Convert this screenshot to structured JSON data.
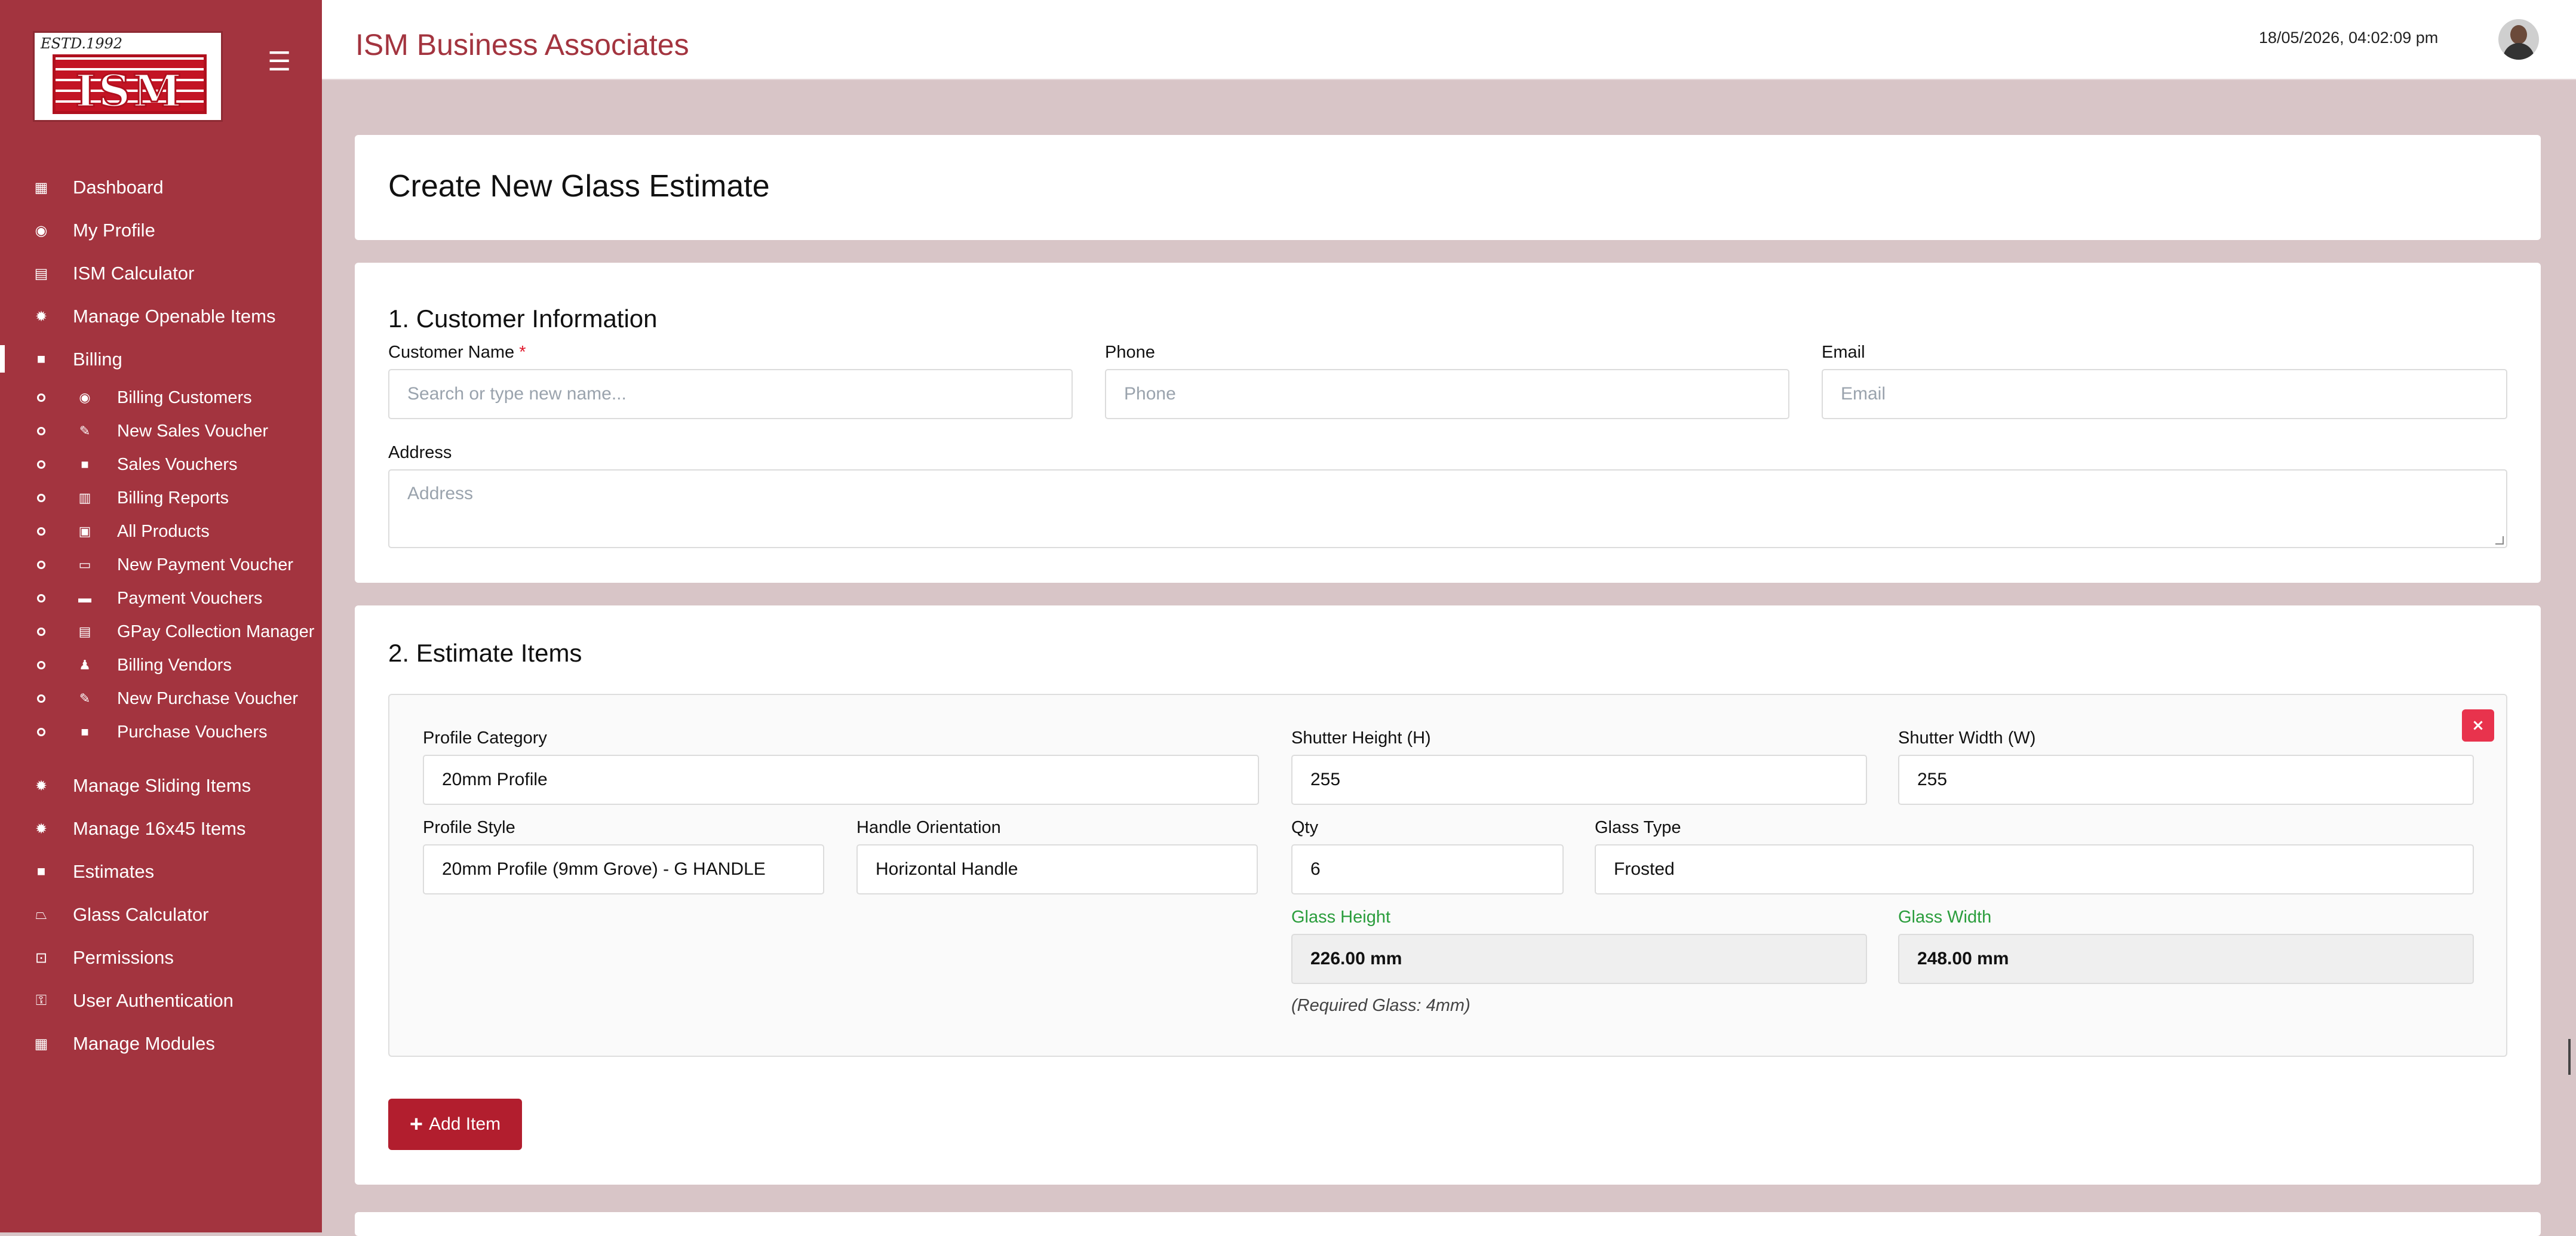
{
  "brand": {
    "logo_estd": "ESTD.1992",
    "logo_text": "ISM",
    "app_title": "ISM Business Associates"
  },
  "header": {
    "datetime": "18/05/2026, 04:02:09 pm"
  },
  "sidebar": {
    "menu_icon": "hamburger-icon",
    "items": [
      {
        "label": "Dashboard",
        "icon": "dashboard-icon"
      },
      {
        "label": "My Profile",
        "icon": "user-circle-icon"
      },
      {
        "label": "ISM Calculator",
        "icon": "calculator-icon"
      },
      {
        "label": "Manage Openable Items",
        "icon": "gear-icon"
      },
      {
        "label": "Billing",
        "icon": "billing-icon",
        "active": true
      }
    ],
    "billing_sub": [
      {
        "label": "Billing Customers",
        "icon": "user-circle-icon"
      },
      {
        "label": "New Sales Voucher",
        "icon": "edit-icon"
      },
      {
        "label": "Sales Vouchers",
        "icon": "receipt-icon"
      },
      {
        "label": "Billing Reports",
        "icon": "report-icon"
      },
      {
        "label": "All Products",
        "icon": "box-icon"
      },
      {
        "label": "New Payment Voucher",
        "icon": "money-icon"
      },
      {
        "label": "Payment Vouchers",
        "icon": "wallet-icon"
      },
      {
        "label": "GPay Collection Manager",
        "icon": "card-icon"
      },
      {
        "label": "Billing Vendors",
        "icon": "person-icon"
      },
      {
        "label": "New Purchase Voucher",
        "icon": "edit-icon"
      },
      {
        "label": "Purchase Vouchers",
        "icon": "receipt-icon"
      }
    ],
    "items_after": [
      {
        "label": "Manage Sliding Items",
        "icon": "gear-icon"
      },
      {
        "label": "Manage 16x45 Items",
        "icon": "gear-icon"
      },
      {
        "label": "Estimates",
        "icon": "document-icon"
      },
      {
        "label": "Glass Calculator",
        "icon": "glass-icon"
      },
      {
        "label": "Permissions",
        "icon": "lock-icon"
      },
      {
        "label": "User Authentication",
        "icon": "user-key-icon"
      },
      {
        "label": "Manage Modules",
        "icon": "modules-icon"
      }
    ]
  },
  "page": {
    "title": "Create New Glass Estimate"
  },
  "customer": {
    "section_title": "1. Customer Information",
    "name_label": "Customer Name",
    "required_mark": "*",
    "name_placeholder": "Search or type new name...",
    "phone_label": "Phone",
    "phone_placeholder": "Phone",
    "email_label": "Email",
    "email_placeholder": "Email",
    "address_label": "Address",
    "address_placeholder": "Address"
  },
  "items": {
    "section_title": "2. Estimate Items",
    "remove_label": "×",
    "profile_category_label": "Profile Category",
    "profile_category_value": "20mm Profile",
    "shutter_height_label": "Shutter Height (H)",
    "shutter_height_value": "255",
    "shutter_width_label": "Shutter Width (W)",
    "shutter_width_value": "255",
    "profile_style_label": "Profile Style",
    "profile_style_value": "20mm Profile (9mm Grove) - G HANDLE",
    "handle_orientation_label": "Handle Orientation",
    "handle_orientation_value": "Horizontal Handle",
    "qty_label": "Qty",
    "qty_value": "6",
    "glass_type_label": "Glass Type",
    "glass_type_value": "Frosted",
    "glass_height_label": "Glass Height",
    "glass_height_value": "226.00 mm",
    "glass_width_label": "Glass Width",
    "glass_width_value": "248.00 mm",
    "required_glass_note": "(Required Glass: 4mm)",
    "add_button_icon": "plus-icon",
    "add_button_label": "Add Item"
  },
  "colors": {
    "brand": "#a3343f",
    "background": "#d8c5c7",
    "remove": "#e8334d",
    "add_button": "#b21e2e",
    "computed_label": "#2a9d3c"
  }
}
